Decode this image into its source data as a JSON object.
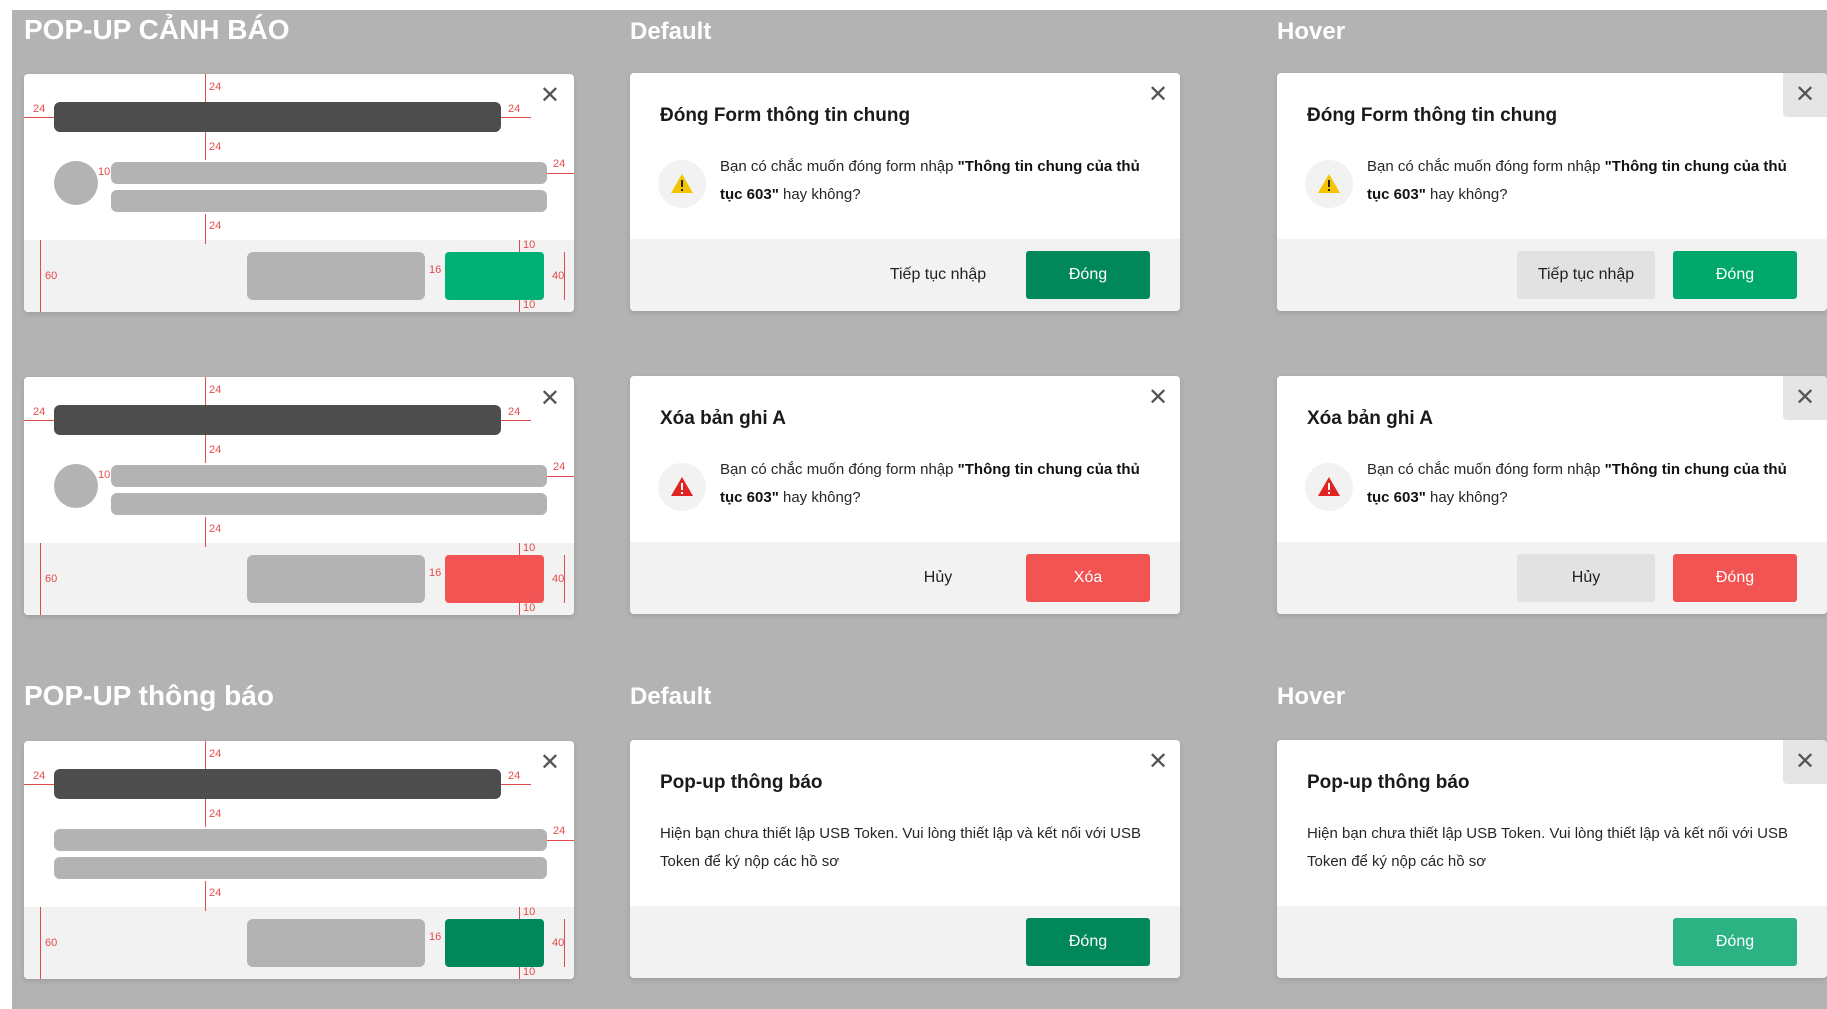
{
  "headings": {
    "warning_popup": "POP-UP CẢNH BÁO",
    "notice_popup": "POP-UP thông báo",
    "default": "Default",
    "hover": "Hover"
  },
  "colors": {
    "board_bg": "#b3b3b3",
    "green": "#00a86b",
    "green_dark": "#00875a",
    "green_light": "#2db383",
    "red": "#f25353",
    "warning_yellow": "#f5c400",
    "danger_red": "#e02424",
    "spec_red": "#e34b4b"
  },
  "spec_measures": {
    "top": "24",
    "left": "24",
    "right": "24",
    "gap_title": "24",
    "content_right": "24",
    "icon_gap": "10",
    "content_bottom": "24",
    "footer_height": "60",
    "button_gap": "16",
    "button_height": "40",
    "footer_top": "10",
    "footer_bottom": "10"
  },
  "icons": {
    "close": "close-icon",
    "warning": "warning-triangle-icon",
    "danger": "danger-triangle-icon"
  },
  "close_glyph": "✕",
  "dialog_close_form": {
    "title": "Đóng Form thông tin chung",
    "message_prefix": "Bạn có chắc muốn đóng form nhập ",
    "message_bold": "\"Thông tin chung của thủ tục 603\"",
    "message_suffix": " hay không?",
    "secondary_button": "Tiếp tục nhập",
    "primary_button": "Đóng"
  },
  "dialog_delete_default": {
    "title": "Xóa bản ghi A",
    "message_prefix": "Bạn có chắc muốn đóng form nhập ",
    "message_bold": "\"Thông tin chung của thủ tục 603\"",
    "message_suffix": " hay không?",
    "secondary_button": "Hủy",
    "primary_button": "Xóa"
  },
  "dialog_delete_hover": {
    "title": "Xóa bản ghi A",
    "message_prefix": "Bạn có chắc muốn đóng form nhập ",
    "message_bold": "\"Thông tin chung của thủ tục 603\"",
    "message_suffix": " hay không?",
    "secondary_button": "Hủy",
    "primary_button": "Đóng"
  },
  "dialog_notice": {
    "title": "Pop-up thông báo",
    "message": "Hiện bạn chưa thiết lập USB Token. Vui lòng thiết lập và kết nối với USB Token để ký nộp các hồ sơ",
    "primary_button": "Đóng"
  }
}
